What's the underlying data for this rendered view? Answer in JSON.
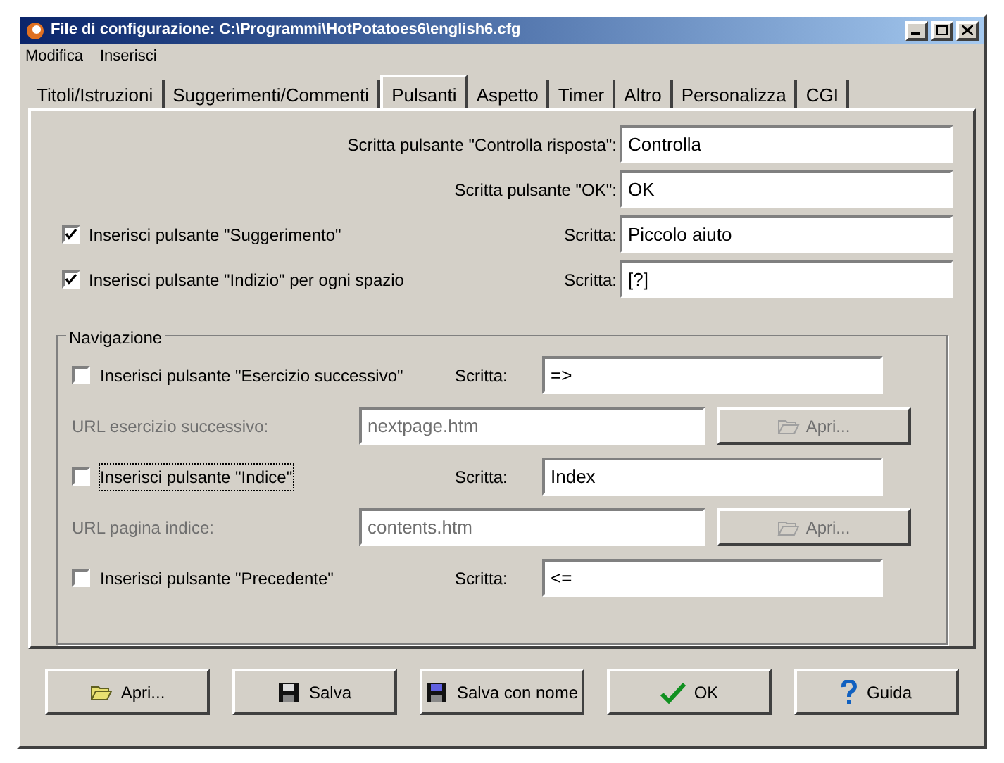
{
  "window": {
    "title": "File di configurazione: C:\\Programmi\\HotPotatoes6\\english6.cfg"
  },
  "menu": [
    "Modifica",
    "Inserisci"
  ],
  "tabs": [
    {
      "label": "Titoli/Istruzioni",
      "selected": false
    },
    {
      "label": "Suggerimenti/Commenti",
      "selected": false
    },
    {
      "label": "Pulsanti",
      "selected": true
    },
    {
      "label": "Aspetto",
      "selected": false
    },
    {
      "label": "Timer",
      "selected": false
    },
    {
      "label": "Altro",
      "selected": false
    },
    {
      "label": "Personalizza",
      "selected": false
    },
    {
      "label": "CGI",
      "selected": false
    }
  ],
  "caption_rows": [
    {
      "kind": "label",
      "label": "Scritta pulsante \"Controlla risposta\":",
      "value": "Controlla"
    },
    {
      "kind": "label",
      "label": "Scritta pulsante \"OK\":",
      "value": "OK"
    },
    {
      "kind": "checkbox",
      "checkbox_label": "Inserisci pulsante \"Suggerimento\"",
      "checked": true,
      "label": "Scritta:",
      "value": "Piccolo aiuto"
    },
    {
      "kind": "checkbox",
      "checkbox_label": "Inserisci pulsante \"Indizio\" per ogni spazio",
      "checked": true,
      "label": "Scritta:",
      "value": "[?]"
    }
  ],
  "navigation": {
    "title": "Navigazione",
    "rows": [
      {
        "kind": "checkbox",
        "checkbox_label": "Inserisci pulsante \"Esercizio successivo\"",
        "checked": false,
        "focused": false,
        "label": "Scritta:",
        "value": "=>"
      },
      {
        "kind": "url",
        "label": "URL esercizio successivo:",
        "value": "nextpage.htm",
        "button": "Apri...",
        "disabled": true
      },
      {
        "kind": "checkbox",
        "checkbox_label": "Inserisci pulsante \"Indice\"",
        "checked": false,
        "focused": true,
        "label": "Scritta:",
        "value": "Index"
      },
      {
        "kind": "url",
        "label": "URL pagina indice:",
        "value": "contents.htm",
        "button": "Apri...",
        "disabled": true
      },
      {
        "kind": "checkbox",
        "checkbox_label": "Inserisci pulsante \"Precedente\"",
        "checked": false,
        "focused": false,
        "label": "Scritta:",
        "value": "<="
      }
    ]
  },
  "buttons": [
    {
      "kind": "open",
      "label": "Apri..."
    },
    {
      "kind": "save",
      "label": "Salva"
    },
    {
      "kind": "save_as",
      "label": "Salva con nome"
    },
    {
      "kind": "ok",
      "label": "OK"
    },
    {
      "kind": "help",
      "label": "Guida"
    }
  ]
}
